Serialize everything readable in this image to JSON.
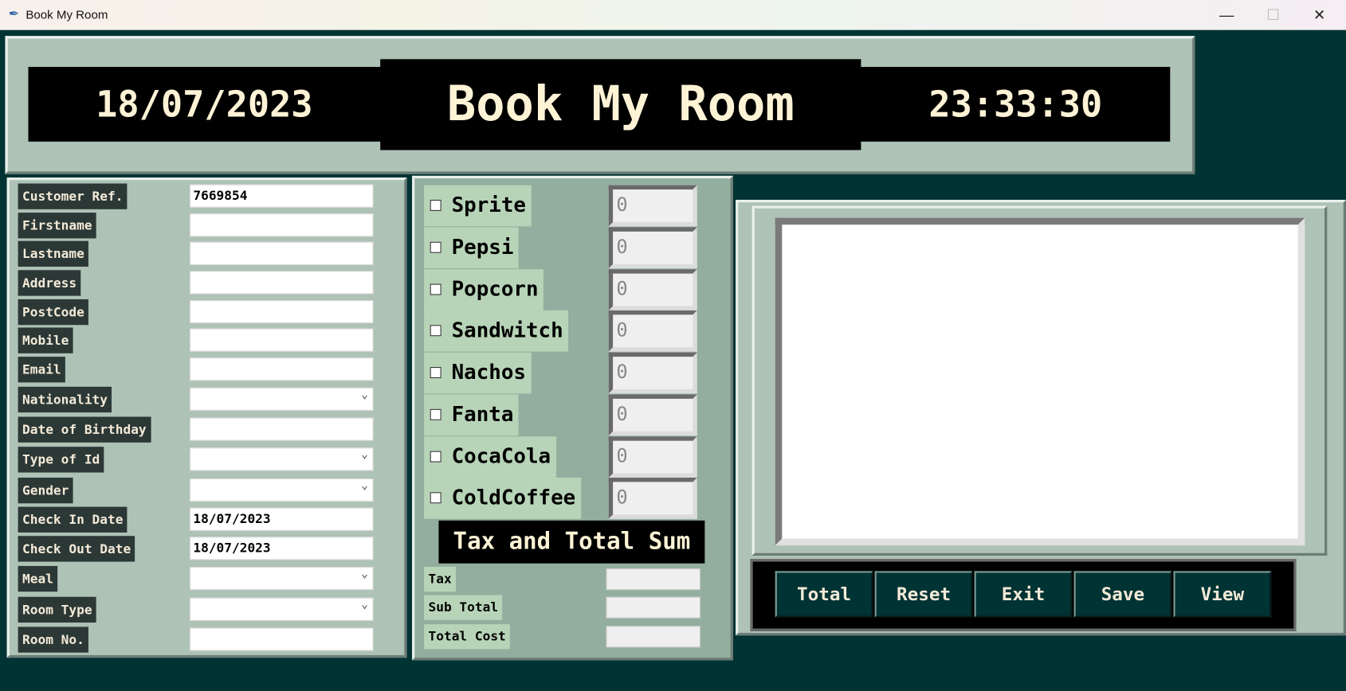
{
  "window": {
    "title": "Book My Room",
    "controls": [
      "minimize",
      "maximize",
      "close"
    ]
  },
  "header": {
    "date": "18/07/2023",
    "title": "Book My Room",
    "time": "23:33:30"
  },
  "customer_form": [
    {
      "label": "Customer Ref.",
      "value": "7669854",
      "type": "entry"
    },
    {
      "label": "Firstname",
      "value": "",
      "type": "entry"
    },
    {
      "label": "Lastname",
      "value": "",
      "type": "entry"
    },
    {
      "label": "Address",
      "value": "",
      "type": "entry"
    },
    {
      "label": "PostCode",
      "value": "",
      "type": "entry"
    },
    {
      "label": "Mobile",
      "value": "",
      "type": "entry"
    },
    {
      "label": "Email",
      "value": "",
      "type": "entry"
    },
    {
      "label": "Nationality",
      "value": "",
      "type": "combo"
    },
    {
      "label": "Date of Birthday",
      "value": "",
      "type": "entry"
    },
    {
      "label": "Type of Id",
      "value": "",
      "type": "combo"
    },
    {
      "label": "Gender",
      "value": "",
      "type": "combo"
    },
    {
      "label": "Check In Date",
      "value": "18/07/2023",
      "type": "entry"
    },
    {
      "label": "Check Out Date",
      "value": "18/07/2023",
      "type": "entry"
    },
    {
      "label": "Meal",
      "value": "",
      "type": "combo"
    },
    {
      "label": "Room Type",
      "value": "",
      "type": "combo"
    },
    {
      "label": "Room No.",
      "value": "",
      "type": "entry"
    }
  ],
  "items": [
    {
      "label": "Sprite",
      "qty": "0",
      "checked": false
    },
    {
      "label": "Pepsi",
      "qty": "0",
      "checked": false
    },
    {
      "label": "Popcorn",
      "qty": "0",
      "checked": false
    },
    {
      "label": "Sandwitch",
      "qty": "0",
      "checked": false
    },
    {
      "label": "Nachos",
      "qty": "0",
      "checked": false
    },
    {
      "label": "Fanta",
      "qty": "0",
      "checked": false
    },
    {
      "label": "CocaCola",
      "qty": "0",
      "checked": false
    },
    {
      "label": "ColdCoffee",
      "qty": "0",
      "checked": false
    }
  ],
  "totals": {
    "heading": "Tax and Total Sum",
    "rows": [
      {
        "label": "Tax",
        "value": ""
      },
      {
        "label": "Sub Total",
        "value": ""
      },
      {
        "label": "Total Cost",
        "value": ""
      }
    ]
  },
  "receipt": {
    "text": ""
  },
  "buttons": [
    "Total",
    "Reset",
    "Exit",
    "Save",
    "View"
  ],
  "colors": {
    "background": "#003333",
    "panel": "#aec2b6",
    "items_panel": "#93ae9e",
    "label_bg": "#2c3836",
    "text_cream": "#fff3d6"
  }
}
